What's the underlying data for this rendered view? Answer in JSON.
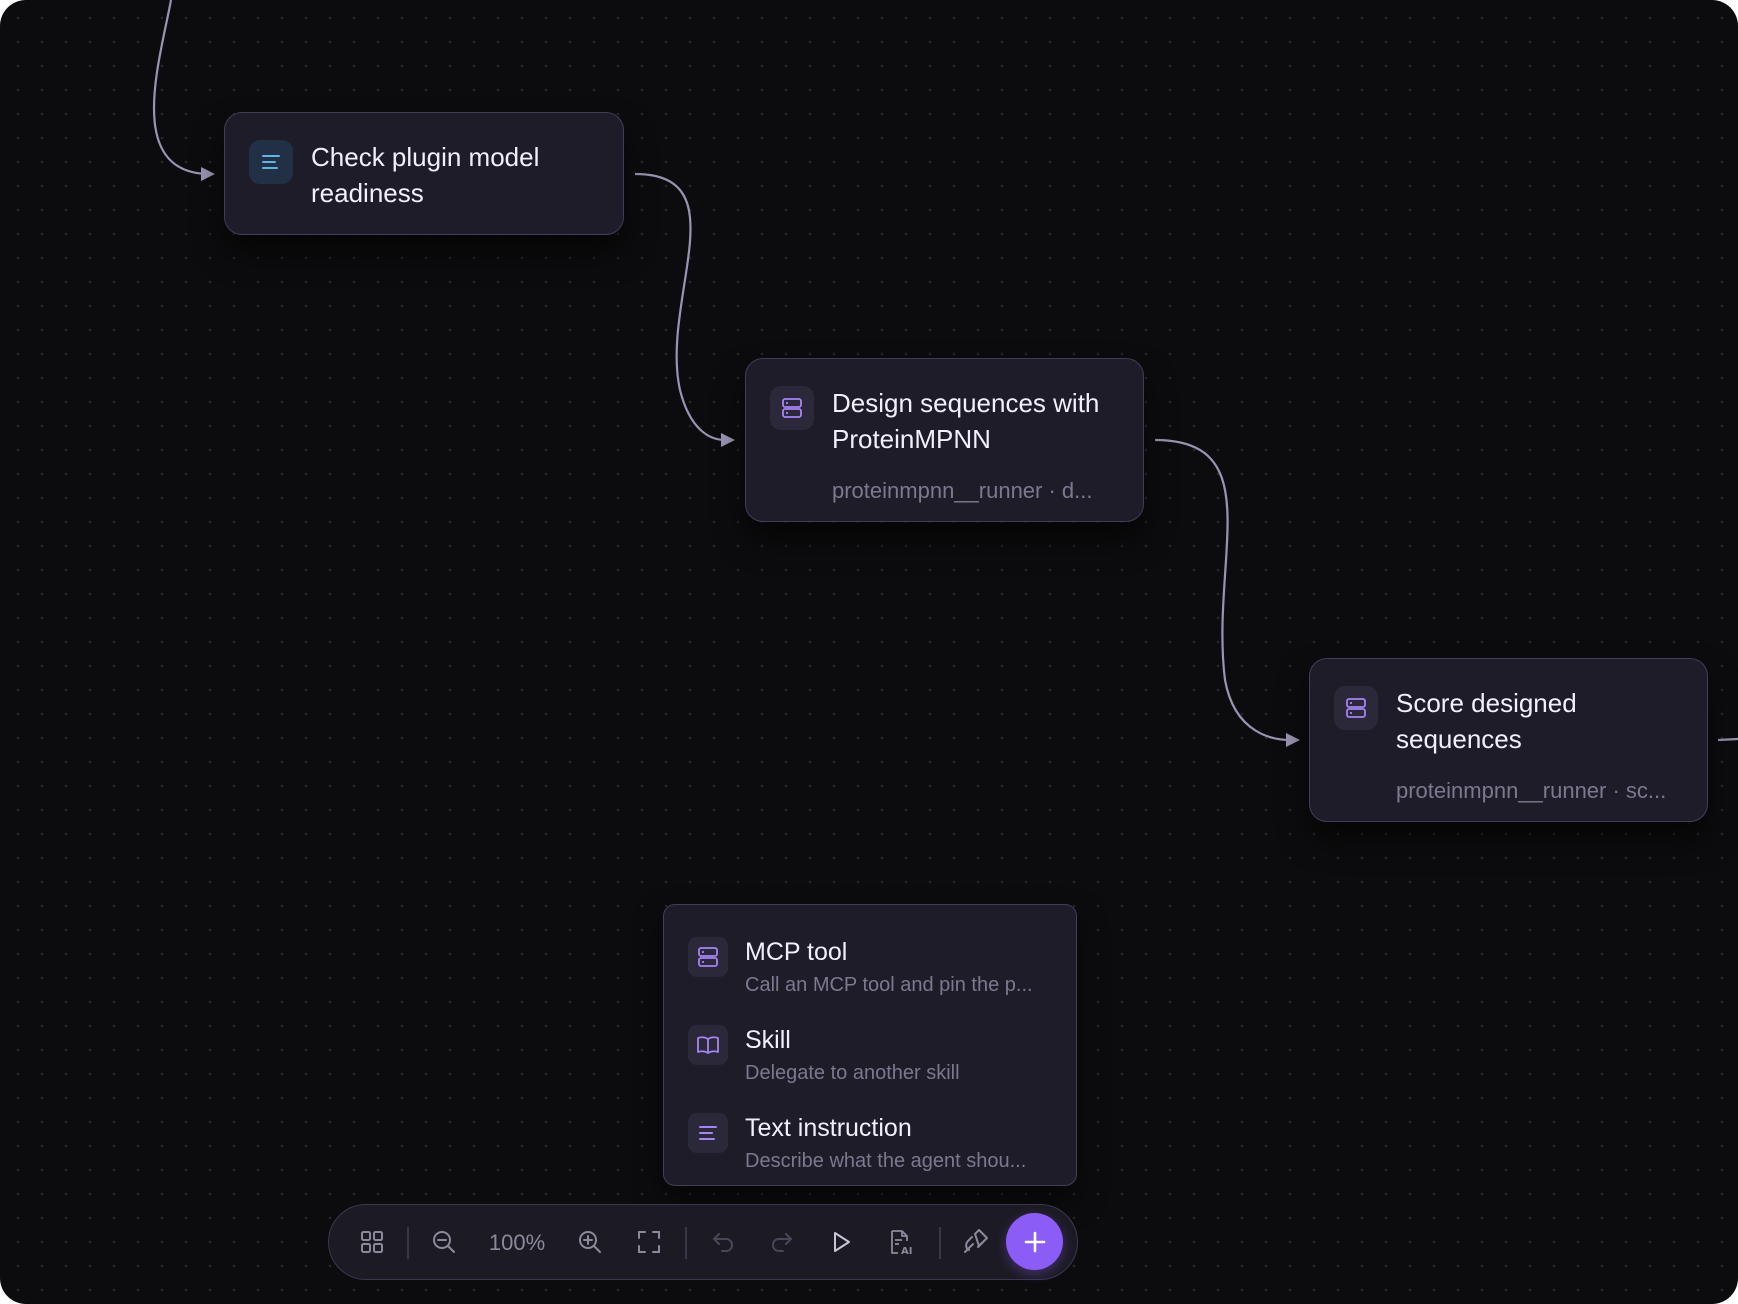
{
  "nodes": [
    {
      "title": "Check plugin model readiness",
      "subtitle": "",
      "icon": "text-lines-icon",
      "type": "text-instruction"
    },
    {
      "title": "Design sequences with ProteinMPNN",
      "subtitle": "proteinmpnn__runner · d...",
      "icon": "server-icon",
      "type": "mcp-tool"
    },
    {
      "title": "Score designed sequences",
      "subtitle": "proteinmpnn__runner · sc...",
      "icon": "server-icon",
      "type": "mcp-tool"
    }
  ],
  "add_menu": {
    "items": [
      {
        "label": "MCP tool",
        "description": "Call an MCP tool and pin the p...",
        "icon": "server-icon"
      },
      {
        "label": "Skill",
        "description": "Delegate to another skill",
        "icon": "book-icon"
      },
      {
        "label": "Text instruction",
        "description": "Describe what the agent shou...",
        "icon": "text-lines-icon"
      }
    ]
  },
  "toolbar": {
    "zoom_level": "100%",
    "buttons": [
      "grid-icon",
      "zoom-out-icon",
      "zoom-in-icon",
      "fit-view-icon",
      "undo-icon",
      "redo-icon",
      "play-icon",
      "ai-document-icon",
      "link-edit-icon",
      "plus-icon"
    ]
  },
  "colors": {
    "canvas_background": "#0c0c0e",
    "node_background": "#1f1c29",
    "node_border": "#423d58",
    "edge": "#9a93b3",
    "accent": "#8b5cf6",
    "text_primary": "#f1eff7",
    "text_secondary": "#7d788f"
  }
}
